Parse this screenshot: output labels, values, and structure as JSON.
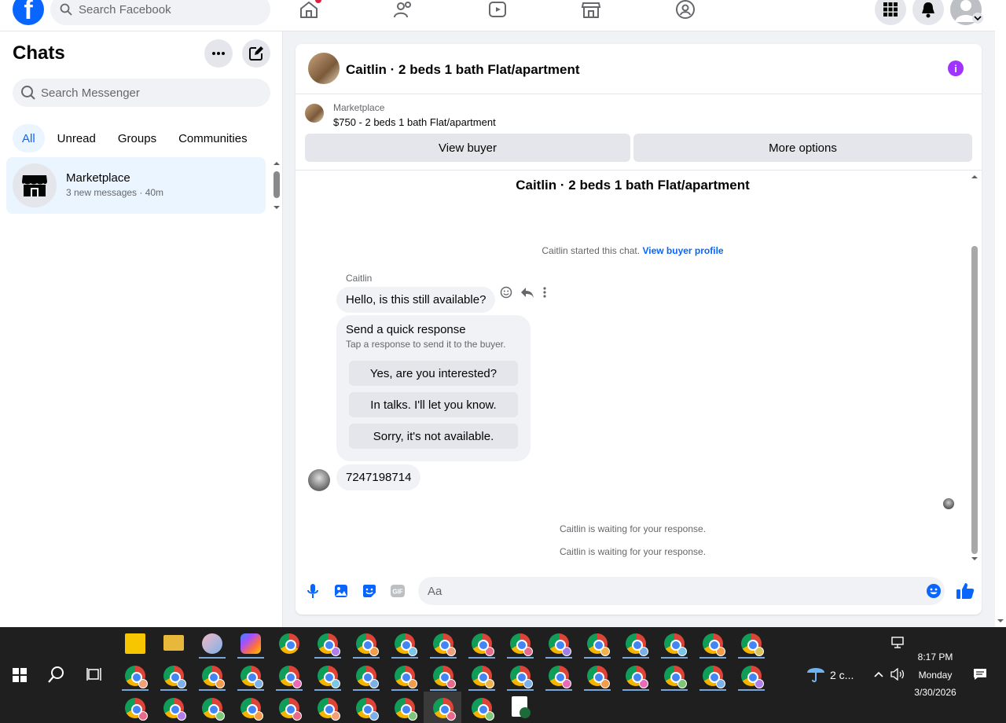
{
  "topbar": {
    "logo_letter": "f",
    "search_placeholder": "Search Facebook"
  },
  "sidebar": {
    "title": "Chats",
    "search_placeholder": "Search Messenger",
    "filters": [
      "All",
      "Unread",
      "Groups",
      "Communities"
    ],
    "active_filter": "All",
    "chats": [
      {
        "name": "Marketplace",
        "subtitle": "3 new messages · 40m"
      }
    ]
  },
  "conversation": {
    "header_title": "Caitlin · 2 beds 1 bath Flat/apartment",
    "info_icon_glyph": "i",
    "marketplace": {
      "label": "Marketplace",
      "listing": "$750 - 2 beds 1 bath Flat/apartment",
      "view_buyer": "View buyer",
      "more_options": "More options"
    },
    "thread_title": "Caitlin · 2 beds 1 bath Flat/apartment",
    "started_text": "Caitlin started this chat.",
    "view_buyer_profile": "View buyer profile",
    "sender_name": "Caitlin",
    "first_message": "Hello, is this still available?",
    "quick_response": {
      "title": "Send a quick response",
      "subtitle": "Tap a response to send it to the buyer.",
      "options": [
        "Yes, are you interested?",
        "In talks. I'll let you know.",
        "Sorry, it's not available."
      ]
    },
    "second_message": "7247198714",
    "waiting_1": "Caitlin is waiting for your response.",
    "waiting_2": "Caitlin is waiting for your response.",
    "composer_placeholder": "Aa"
  },
  "taskbar": {
    "weather": "2 c...",
    "time": "8:17 PM",
    "day": "Monday",
    "date": "3/30/2026",
    "accent_color": "#0866ff"
  }
}
